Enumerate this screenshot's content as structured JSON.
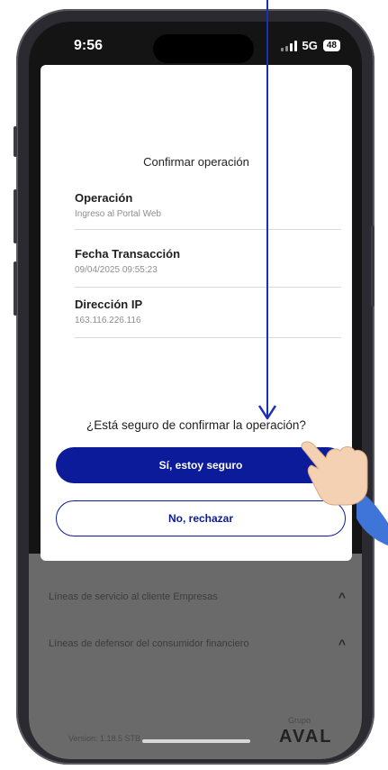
{
  "status_bar": {
    "time": "9:56",
    "network": "5G",
    "battery": "48"
  },
  "modal": {
    "title": "Confirmar operación",
    "details": [
      {
        "label": "Operación",
        "value": "Ingreso al Portal Web"
      },
      {
        "label": "Fecha Transacción",
        "value": "09/04/2025 09:55:23"
      },
      {
        "label": "Dirección IP",
        "value": "163.116.226.116"
      }
    ],
    "question": "¿Está seguro de confirmar la operación?",
    "confirm_label": "Sí, estoy seguro",
    "reject_label": "No, rechazar"
  },
  "background": {
    "rows": [
      "Líneas de servicio al cliente Empresas",
      "Líneas de defensor del consumidor financiero"
    ],
    "version": "Version: 1.18.5 STB",
    "brand_small": "Grupo",
    "brand": "AVAL"
  },
  "colors": {
    "primary": "#0b1b9a",
    "annotation": "#1a2fb8"
  },
  "icons": {
    "row_chevron": "chevron-up-icon",
    "pointer": "hand-pointer-icon",
    "arrow": "down-arrow-icon"
  }
}
